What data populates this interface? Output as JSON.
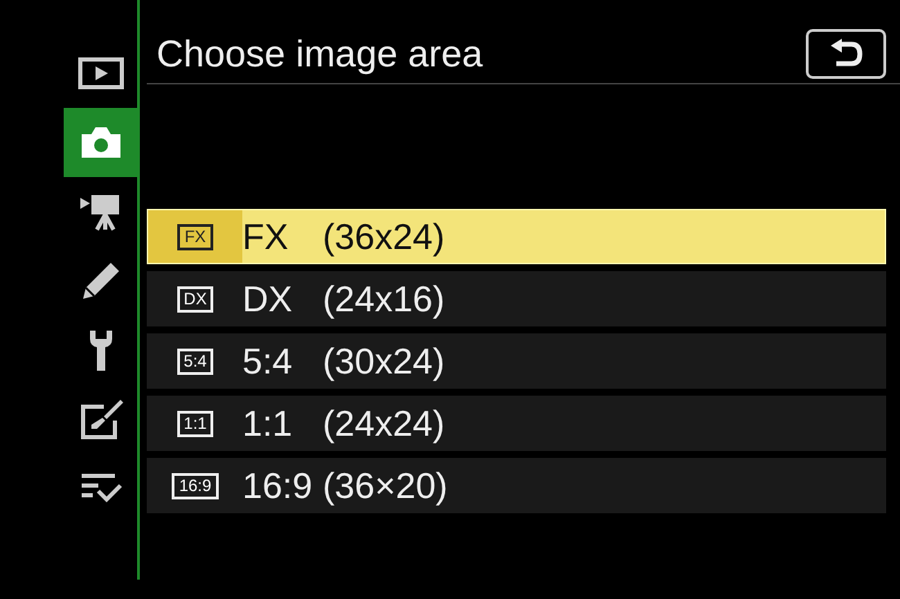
{
  "sidebar": {
    "tabs": [
      {
        "kind": "playback",
        "selected": false
      },
      {
        "kind": "camera",
        "selected": true
      },
      {
        "kind": "movie",
        "selected": false
      },
      {
        "kind": "pencil",
        "selected": false
      },
      {
        "kind": "wrench",
        "selected": false
      },
      {
        "kind": "brush",
        "selected": false
      },
      {
        "kind": "list",
        "selected": false
      }
    ]
  },
  "header": {
    "title": "Choose image area"
  },
  "options": [
    {
      "badge": "FX",
      "label": "FX",
      "size": "(36x24)",
      "selected": true
    },
    {
      "badge": "DX",
      "label": "DX",
      "size": "(24x16)",
      "selected": false
    },
    {
      "badge": "5:4",
      "label": "5:4",
      "size": "(30x24)",
      "selected": false
    },
    {
      "badge": "1:1",
      "label": "1:1",
      "size": "(24x24)",
      "selected": false
    },
    {
      "badge": "16:9",
      "label": "16:9",
      "size": "(36×20)",
      "selected": false
    }
  ]
}
